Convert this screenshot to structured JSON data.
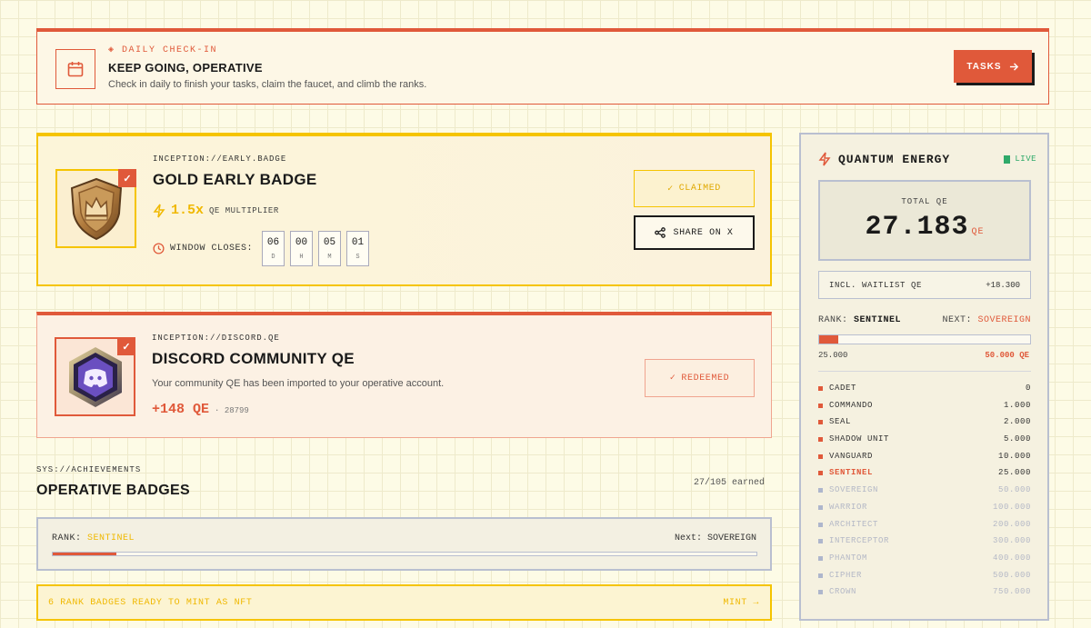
{
  "colors": {
    "accent": "#e0593a",
    "gold": "#f5c400",
    "live": "#2faa6a",
    "muted": "#b9bfd0"
  },
  "banner": {
    "kicker": "◈ DAILY CHECK-IN",
    "title": "KEEP GOING, OPERATIVE",
    "subtitle": "Check in daily to finish your tasks, claim the faucet, and climb the ranks.",
    "button_label": "TASKS",
    "icon": "calendar-icon"
  },
  "gold_card": {
    "kicker": "INCEPTION://EARLY.BADGE",
    "title": "GOLD EARLY BADGE",
    "multiplier": "1.5x",
    "multiplier_label": "QE MULTIPLIER",
    "window_label": "WINDOW CLOSES:",
    "countdown": [
      {
        "value": "06",
        "unit": "D"
      },
      {
        "value": "00",
        "unit": "H"
      },
      {
        "value": "05",
        "unit": "M"
      },
      {
        "value": "01",
        "unit": "S"
      }
    ],
    "claimed_label": "CLAIMED",
    "share_label": "SHARE ON X"
  },
  "discord_card": {
    "kicker": "INCEPTION://DISCORD.QE",
    "title": "DISCORD COMMUNITY QE",
    "subtitle": "Your community QE has been imported to your operative account.",
    "qe": "+148 QE",
    "id": "· 28799",
    "redeemed_label": "REDEEMED"
  },
  "achievements": {
    "kicker": "SYS://ACHIEVEMENTS",
    "title": "OPERATIVE BADGES",
    "earned": "27/105 earned",
    "rank_label": "RANK:",
    "rank": "SENTINEL",
    "next_label": "Next:",
    "next": "SOVEREIGN",
    "progress": 0.09,
    "mint_text": "6 RANK BADGES READY TO MINT AS NFT",
    "mint_label": "MINT →"
  },
  "panel": {
    "title": "QUANTUM ENERGY",
    "live_label": "LIVE",
    "total_label": "TOTAL QE",
    "total_value": "27.183",
    "total_unit": "QE",
    "waitlist_label": "INCL. WAITLIST QE",
    "waitlist_value": "+18.300",
    "rank_label": "RANK:",
    "rank": "SENTINEL",
    "next_label": "NEXT:",
    "next": "SOVEREIGN",
    "progress": 0.09,
    "range_min": "25.000",
    "range_max": "50.000 QE",
    "tiers": [
      {
        "name": "CADET",
        "value": "0",
        "state": "done"
      },
      {
        "name": "COMMANDO",
        "value": "1.000",
        "state": "done"
      },
      {
        "name": "SEAL",
        "value": "2.000",
        "state": "done"
      },
      {
        "name": "SHADOW UNIT",
        "value": "5.000",
        "state": "done"
      },
      {
        "name": "VANGUARD",
        "value": "10.000",
        "state": "done"
      },
      {
        "name": "SENTINEL",
        "value": "25.000",
        "state": "current"
      },
      {
        "name": "SOVEREIGN",
        "value": "50.000",
        "state": "locked"
      },
      {
        "name": "WARRIOR",
        "value": "100.000",
        "state": "locked"
      },
      {
        "name": "ARCHITECT",
        "value": "200.000",
        "state": "locked"
      },
      {
        "name": "INTERCEPTOR",
        "value": "300.000",
        "state": "locked"
      },
      {
        "name": "PHANTOM",
        "value": "400.000",
        "state": "locked"
      },
      {
        "name": "CIPHER",
        "value": "500.000",
        "state": "locked"
      },
      {
        "name": "CROWN",
        "value": "750.000",
        "state": "locked"
      }
    ]
  }
}
